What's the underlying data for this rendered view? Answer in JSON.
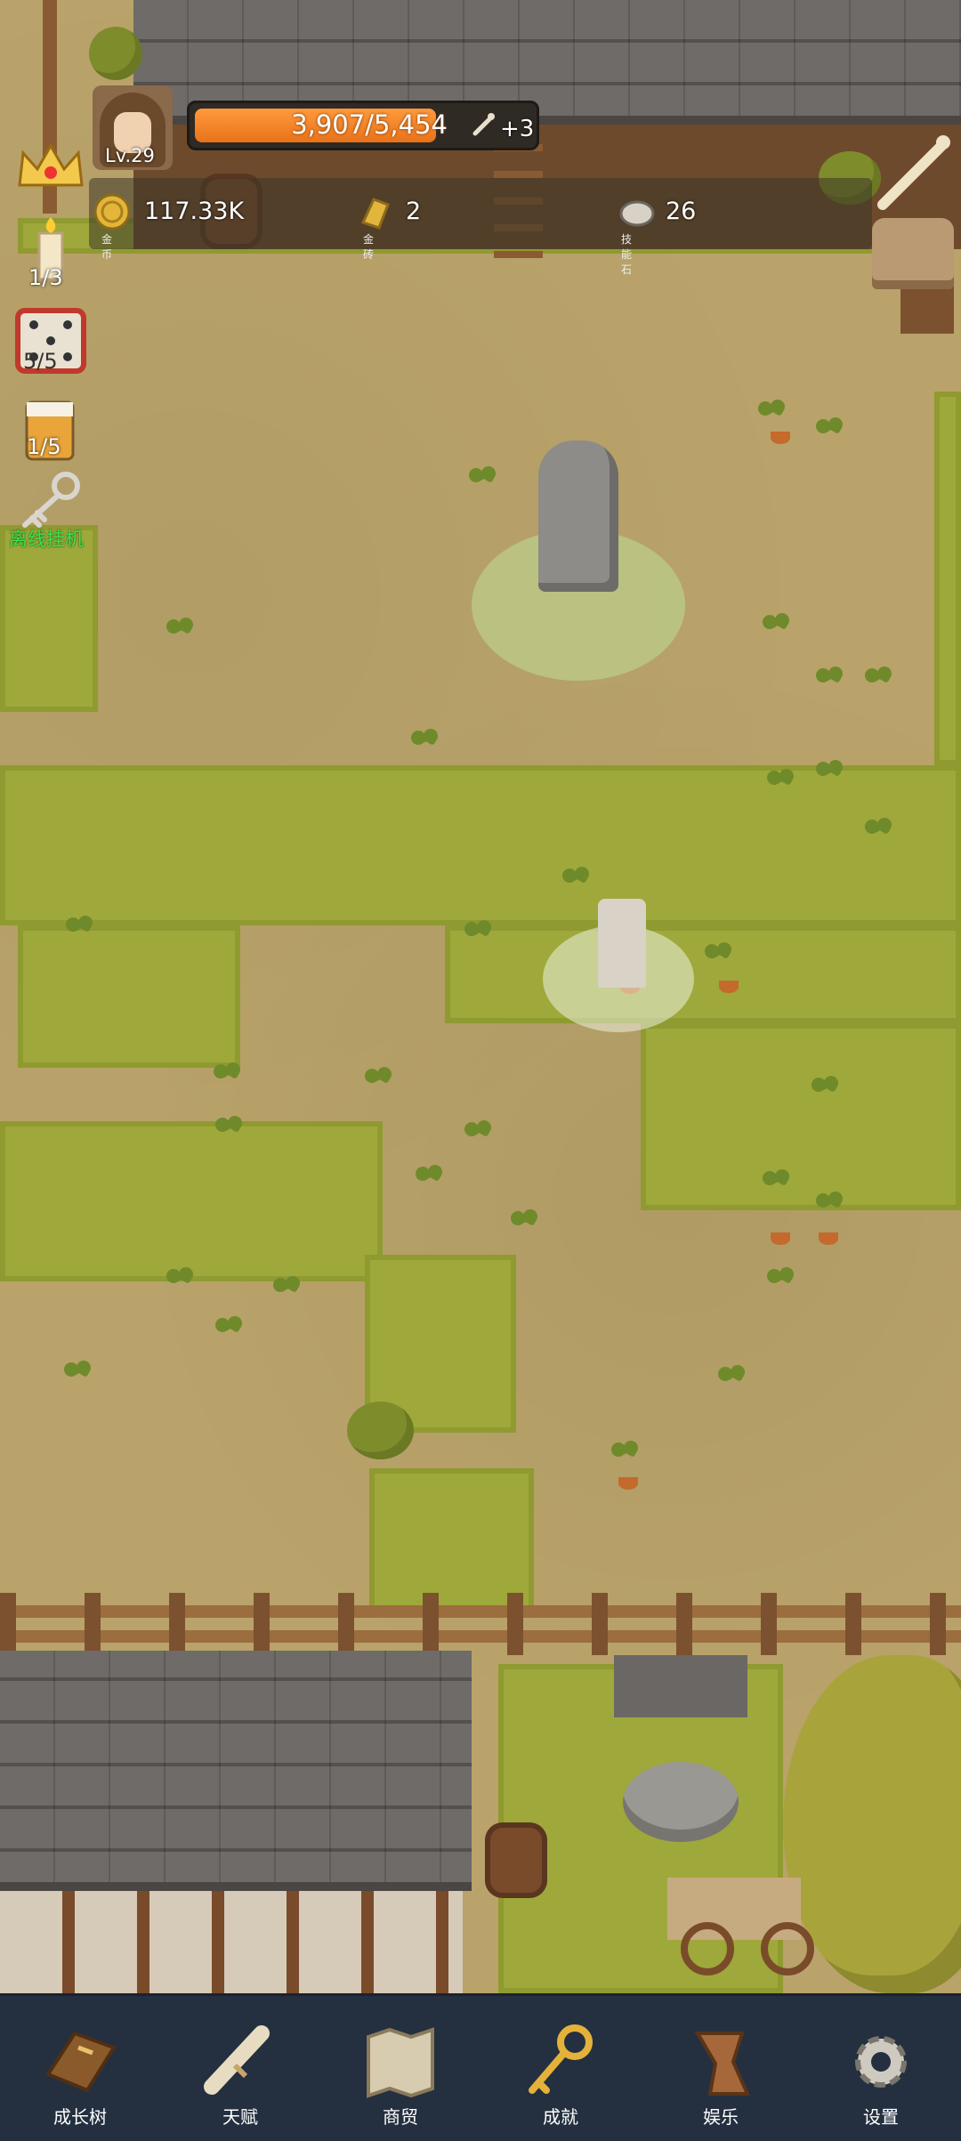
{
  "player": {
    "level": "Lv.29"
  },
  "exp": {
    "current_text": "3,907/5,454",
    "fraction": 0.716,
    "bonus": "+3"
  },
  "resources": [
    {
      "icon": "gold-coin-icon",
      "value": "117.33K",
      "label": "金币"
    },
    {
      "icon": "gold-brick-icon",
      "value": "2",
      "label": "金砖"
    },
    {
      "icon": "skill-stone-icon",
      "value": "26",
      "label": "技能石"
    }
  ],
  "side": {
    "candle_count": "1/3",
    "dice_count": "5/5",
    "beer_count": "1/5",
    "idle_label": "离线挂机"
  },
  "nav": {
    "items": [
      {
        "label": "成长树",
        "icon": "book-icon"
      },
      {
        "label": "天赋",
        "icon": "scroll-icon"
      },
      {
        "label": "商贸",
        "icon": "map-icon"
      },
      {
        "label": "成就",
        "icon": "key-icon"
      },
      {
        "label": "娱乐",
        "icon": "leather-icon"
      },
      {
        "label": "设置",
        "icon": "gear-icon"
      }
    ]
  },
  "colors": {
    "exp_fill": "#f08024",
    "idle_green": "#3fe04a",
    "nav_bg": "#243040"
  }
}
